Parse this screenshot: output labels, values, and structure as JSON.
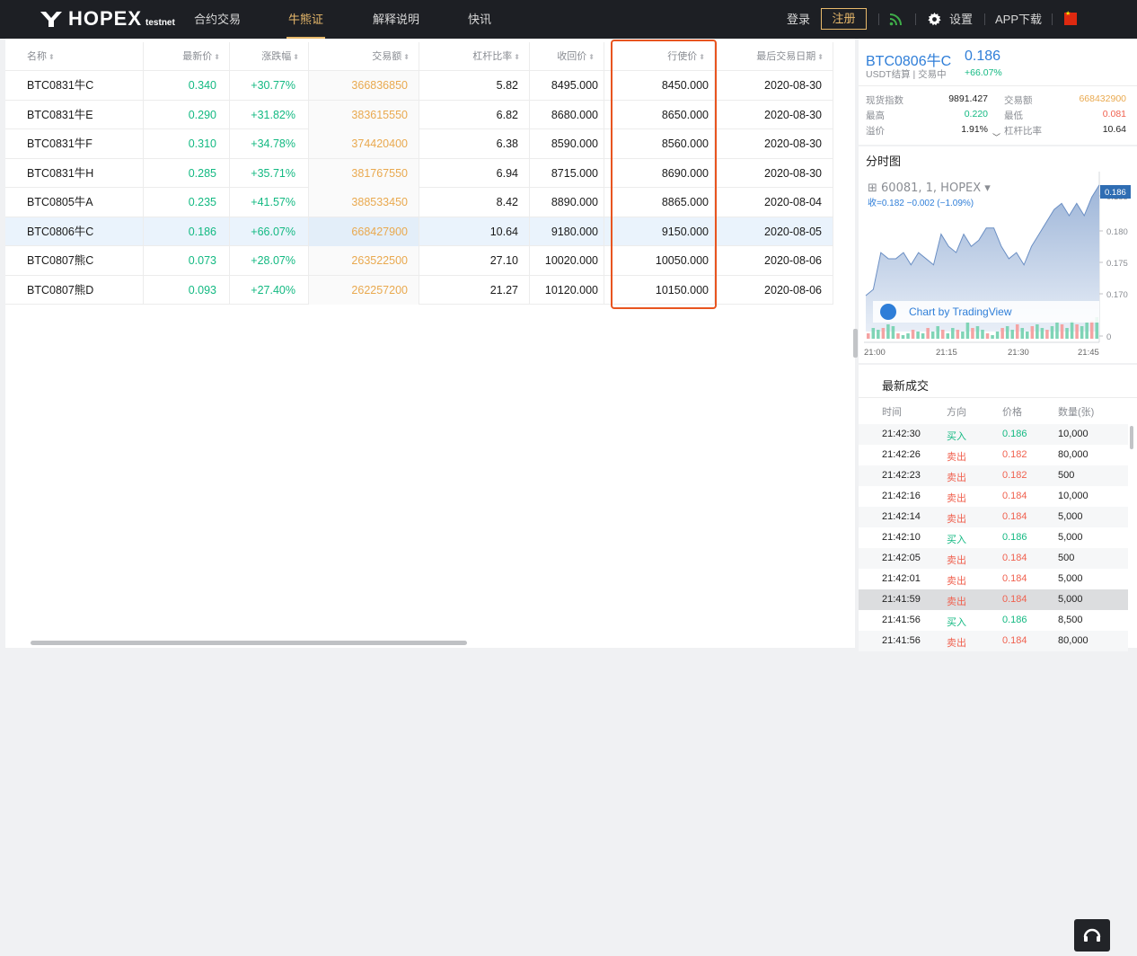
{
  "nav": {
    "logo_text": "HOPEX",
    "logo_tag": "testnet",
    "items": [
      "合约交易",
      "牛熊证",
      "解释说明",
      "快讯"
    ],
    "active_index": 1,
    "login": "登录",
    "register": "注册",
    "settings": "设置",
    "app": "APP下载",
    "accent_color": "#e8b96b"
  },
  "table": {
    "headers": [
      "名称",
      "最新价",
      "涨跌幅",
      "交易额",
      "杠杆比率",
      "收回价",
      "行使价",
      "最后交易日期"
    ],
    "rows": [
      {
        "name": "BTC0831牛C",
        "price": "0.340",
        "change": "+30.77%",
        "volume": "366836850",
        "leverage": "5.82",
        "recall": "8495.000",
        "strike": "8450.000",
        "date": "2020-08-30"
      },
      {
        "name": "BTC0831牛E",
        "price": "0.290",
        "change": "+31.82%",
        "volume": "383615550",
        "leverage": "6.82",
        "recall": "8680.000",
        "strike": "8650.000",
        "date": "2020-08-30"
      },
      {
        "name": "BTC0831牛F",
        "price": "0.310",
        "change": "+34.78%",
        "volume": "374420400",
        "leverage": "6.38",
        "recall": "8590.000",
        "strike": "8560.000",
        "date": "2020-08-30"
      },
      {
        "name": "BTC0831牛H",
        "price": "0.285",
        "change": "+35.71%",
        "volume": "381767550",
        "leverage": "6.94",
        "recall": "8715.000",
        "strike": "8690.000",
        "date": "2020-08-30"
      },
      {
        "name": "BTC0805牛A",
        "price": "0.235",
        "change": "+41.57%",
        "volume": "388533450",
        "leverage": "8.42",
        "recall": "8890.000",
        "strike": "8865.000",
        "date": "2020-08-04"
      },
      {
        "name": "BTC0806牛C",
        "price": "0.186",
        "change": "+66.07%",
        "volume": "668427900",
        "leverage": "10.64",
        "recall": "9180.000",
        "strike": "9150.000",
        "date": "2020-08-05"
      },
      {
        "name": "BTC0807熊C",
        "price": "0.073",
        "change": "+28.07%",
        "volume": "263522500",
        "leverage": "27.10",
        "recall": "10020.000",
        "strike": "10050.000",
        "date": "2020-08-06"
      },
      {
        "name": "BTC0807熊D",
        "price": "0.093",
        "change": "+27.40%",
        "volume": "262257200",
        "leverage": "21.27",
        "recall": "10120.000",
        "strike": "10150.000",
        "date": "2020-08-06"
      }
    ],
    "selected_index": 5
  },
  "ticker": {
    "name": "BTC0806牛C",
    "price": "0.186",
    "settle": "USDT结算",
    "status": "交易中",
    "change": "+66.07%",
    "stats": [
      {
        "label": "现货指数",
        "value": "9891.427"
      },
      {
        "label": "交易额",
        "value": "668432900"
      },
      {
        "label": "最高",
        "value": "0.220"
      },
      {
        "label": "最低",
        "value": "0.081"
      },
      {
        "label": "溢价",
        "value": "1.91%"
      },
      {
        "label": "杠杆比率",
        "value": "10.64"
      }
    ]
  },
  "chart": {
    "title": "分时图",
    "symbol_line": "60081, 1, HOPEX",
    "close_label": "收=",
    "close_value": "0.182",
    "close_change": "−0.002 (−1.09%)",
    "price_badge": "0.186",
    "watermark": "Chart by TradingView",
    "y_ticks": [
      "0.185",
      "0.180",
      "0.175",
      "0.170",
      "0"
    ],
    "x_ticks": [
      "21:00",
      "21:15",
      "21:30",
      "21:45"
    ]
  },
  "chart_data": {
    "type": "area",
    "x_labels": [
      "21:00",
      "21:15",
      "21:30",
      "21:45"
    ],
    "ylim": [
      0.168,
      0.187
    ],
    "series": [
      {
        "values": [
          0.168,
          0.169,
          0.175,
          0.174,
          0.174,
          0.175,
          0.173,
          0.175,
          0.174,
          0.173,
          0.178,
          0.176,
          0.175,
          0.178,
          0.176,
          0.177,
          0.179,
          0.179,
          0.176,
          0.174,
          0.175,
          0.173,
          0.176,
          0.178,
          0.18,
          0.182,
          0.183,
          0.181,
          0.183,
          0.181,
          0.184,
          0.186
        ]
      }
    ],
    "volume": [
      3,
      6,
      5,
      6,
      8,
      7,
      3,
      2,
      3,
      5,
      4,
      3,
      6,
      4,
      7,
      5,
      3,
      6,
      5,
      4,
      9,
      6,
      7,
      5,
      3,
      2,
      4,
      6,
      7,
      5,
      8,
      6,
      4,
      7,
      8,
      6,
      5,
      7,
      9,
      8,
      6,
      10,
      8,
      7,
      9,
      10,
      12
    ]
  },
  "trades": {
    "title": "最新成交",
    "headers": [
      "时间",
      "方向",
      "价格",
      "数量(张)"
    ],
    "rows": [
      {
        "time": "21:42:30",
        "side": "买入",
        "price": "0.186",
        "qty": "10,000",
        "buy": true
      },
      {
        "time": "21:42:26",
        "side": "卖出",
        "price": "0.182",
        "qty": "80,000",
        "buy": false
      },
      {
        "time": "21:42:23",
        "side": "卖出",
        "price": "0.182",
        "qty": "500",
        "buy": false
      },
      {
        "time": "21:42:16",
        "side": "卖出",
        "price": "0.184",
        "qty": "10,000",
        "buy": false
      },
      {
        "time": "21:42:14",
        "side": "卖出",
        "price": "0.184",
        "qty": "5,000",
        "buy": false
      },
      {
        "time": "21:42:10",
        "side": "买入",
        "price": "0.186",
        "qty": "5,000",
        "buy": true
      },
      {
        "time": "21:42:05",
        "side": "卖出",
        "price": "0.184",
        "qty": "500",
        "buy": false
      },
      {
        "time": "21:42:01",
        "side": "卖出",
        "price": "0.184",
        "qty": "5,000",
        "buy": false
      },
      {
        "time": "21:41:59",
        "side": "卖出",
        "price": "0.184",
        "qty": "5,000",
        "buy": false
      },
      {
        "time": "21:41:56",
        "side": "买入",
        "price": "0.186",
        "qty": "8,500",
        "buy": true
      },
      {
        "time": "21:41:56",
        "side": "卖出",
        "price": "0.184",
        "qty": "80,000",
        "buy": false
      }
    ]
  }
}
